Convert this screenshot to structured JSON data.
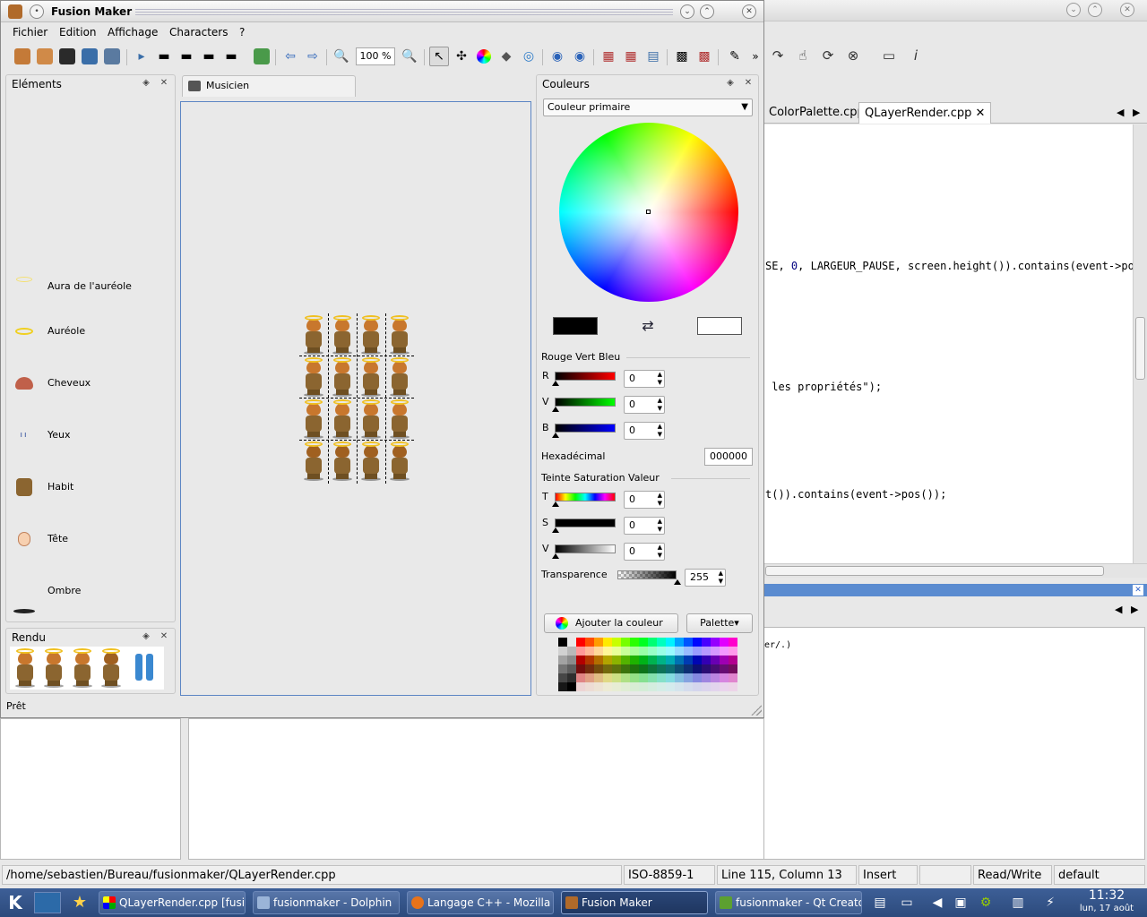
{
  "colors": {
    "accent": "#5c86c4",
    "taskbar": "#2c4a7c",
    "code_number": "#000080",
    "code_string": "#008000"
  },
  "qtcreator": {
    "tabs": [
      "ColorPalette.cpp",
      "QLayerRender.cpp"
    ],
    "active_tab": "QLayerRender.cpp",
    "code": {
      "line1_a": "SE, ",
      "line1_num": "0",
      "line1_b": ", LARGEUR_PAUSE, screen.height()).contains(event->pos(",
      "line2": " les propriétés\");",
      "line3": "t()).contains(event->pos());"
    },
    "output_text": "er/.)",
    "statusbar": {
      "path": "/home/sebastien/Bureau/fusionmaker/QLayerRender.cpp",
      "encoding": "ISO-8859-1",
      "position": "Line 115, Column 13",
      "mode": "Insert",
      "access": "Read/Write",
      "style": "default"
    }
  },
  "window": {
    "title": "Fusion Maker",
    "menu": [
      "Fichier",
      "Edition",
      "Affichage",
      "Characters",
      "?"
    ],
    "zoom": "100 %",
    "status": "Prêt"
  },
  "elements_dock": {
    "title": "Eléments",
    "items": [
      {
        "label": "Aura de l'auréole",
        "icon": "aura-icon"
      },
      {
        "label": "Auréole",
        "icon": "halo-icon"
      },
      {
        "label": "Cheveux",
        "icon": "hair-icon"
      },
      {
        "label": "Yeux",
        "icon": "eyes-icon"
      },
      {
        "label": "Habit",
        "icon": "clothes-icon"
      },
      {
        "label": "Tête",
        "icon": "head-icon"
      },
      {
        "label": "Ombre",
        "icon": "shadow-icon"
      }
    ]
  },
  "rendu_dock": {
    "title": "Rendu"
  },
  "document": {
    "tab_label": "Musicien"
  },
  "colors_dock": {
    "title": "Couleurs",
    "selector": "Couleur primaire",
    "primary_color": "#000000",
    "secondary_color": "#ffffff",
    "rgb_title": "Rouge Vert Bleu",
    "rgb": [
      {
        "label": "R",
        "value": "0"
      },
      {
        "label": "V",
        "value": "0"
      },
      {
        "label": "B",
        "value": "0"
      }
    ],
    "hex_label": "Hexadécimal",
    "hex_value": "000000",
    "hsv_title": "Teinte Saturation Valeur",
    "hsv": [
      {
        "label": "T",
        "value": "0"
      },
      {
        "label": "S",
        "value": "0"
      },
      {
        "label": "V",
        "value": "0"
      }
    ],
    "transparency_label": "Transparence",
    "transparency_value": "255",
    "add_color_label": "Ajouter la couleur",
    "palette_label": "Palette"
  },
  "taskbar": {
    "tasks": [
      "QLayerRender.cpp [fusi",
      "fusionmaker - Dolphin",
      "Langage C++ - Mozilla F",
      "Fusion Maker",
      "fusionmaker - Qt Creato"
    ],
    "active_task": "Fusion Maker",
    "time": "11:32",
    "date": "lun, 17 août"
  }
}
